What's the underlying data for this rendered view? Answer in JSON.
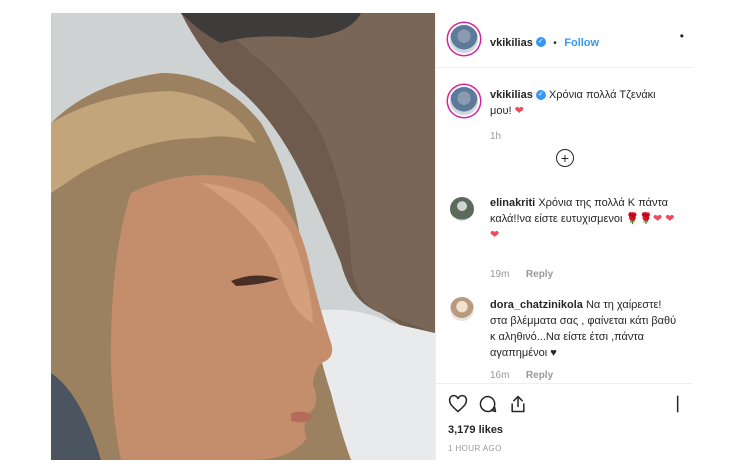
{
  "header": {
    "username": "vkikilias",
    "separator": "•",
    "follow_label": "Follow",
    "more": "•"
  },
  "caption": {
    "username": "vkikilias",
    "text": "Χρόνια πολλά Τζενάκι μου!",
    "emoji": "❤",
    "time": "1h"
  },
  "load_more": "+",
  "comments": [
    {
      "username": "elinakriti",
      "text": "Χρόνια της πολλά Κ πάντα καλά!!να είστε ευτυχισμενοι",
      "emoji": "🌹🌹❤ ❤❤",
      "time": "19m",
      "reply": "Reply"
    },
    {
      "username": "dora_chatzinikola",
      "text": "Να τη χαίρεστε!στα βλέμματα σας , φαίνεται κάτι βαθύ κ αληθινό...Να είστε έτσι ,πάντα αγαπημένοι",
      "emoji": "♥",
      "time": "16m",
      "reply": "Reply"
    }
  ],
  "actions": {
    "likes": "3,179 likes",
    "posted": "1 HOUR AGO"
  },
  "colors": {
    "accent": "#3897f0",
    "heart": "#ed4956",
    "muted": "#999999"
  }
}
